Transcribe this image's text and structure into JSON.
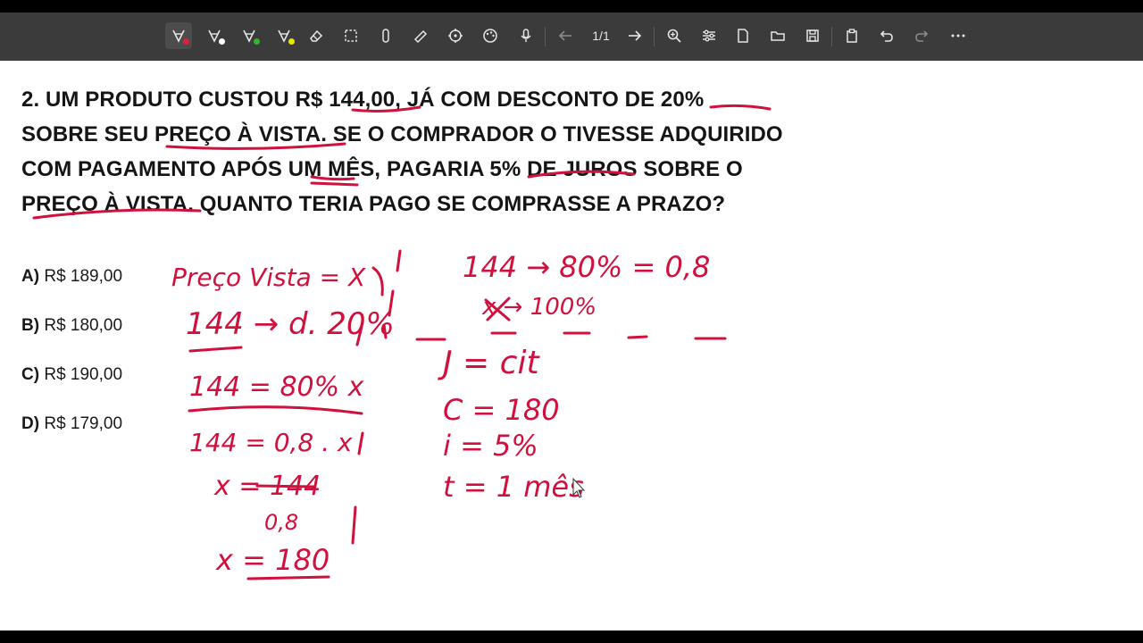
{
  "toolbar": {
    "page_counter": "1/1",
    "tools": [
      {
        "icon": "highlighter-pen-red-icon",
        "color": "#e0203a"
      },
      {
        "icon": "pen-white-icon",
        "color": "#ffffff"
      },
      {
        "icon": "pen-green-icon",
        "color": "#2fb52f"
      },
      {
        "icon": "pen-yellow-icon",
        "color": "#e6e600"
      },
      {
        "icon": "eraser-icon"
      },
      {
        "icon": "select-area-icon"
      },
      {
        "icon": "attach-icon"
      },
      {
        "icon": "ruler-icon"
      },
      {
        "icon": "move-icon"
      },
      {
        "icon": "palette-icon"
      },
      {
        "icon": "microphone-icon"
      },
      {
        "icon": "arrow-left-icon"
      },
      {
        "icon": "arrow-right-icon"
      },
      {
        "icon": "zoom-icon"
      },
      {
        "icon": "settings-sliders-icon"
      },
      {
        "icon": "new-file-icon"
      },
      {
        "icon": "open-folder-icon"
      },
      {
        "icon": "save-icon"
      },
      {
        "icon": "clipboard-icon"
      },
      {
        "icon": "undo-icon"
      },
      {
        "icon": "redo-icon"
      },
      {
        "icon": "more-icon"
      }
    ]
  },
  "question": {
    "lines": [
      "2. UM PRODUTO CUSTOU R$ 144,00, JÁ COM DESCONTO DE 20%",
      "SOBRE SEU PREÇO À VISTA. SE O COMPRADOR O TIVESSE ADQUIRIDO",
      "COM PAGAMENTO APÓS UM MÊS, PAGARIA 5% DE JUROS SOBRE O",
      "PREÇO À VISTA. QUANTO TERIA PAGO SE COMPRASSE A PRAZO?"
    ]
  },
  "options": [
    {
      "letter": "A)",
      "value": "R$ 189,00"
    },
    {
      "letter": "B)",
      "value": "R$ 180,00"
    },
    {
      "letter": "C)",
      "value": "R$ 190,00"
    },
    {
      "letter": "D)",
      "value": "R$ 179,00"
    }
  ],
  "ink": {
    "color": "#d0113e",
    "left": [
      "Preço Vista = X",
      "144 → d. 20%",
      "144 = 80% x",
      "144 = 0,8 . x",
      "x = 144",
      "0,8",
      "x = 180"
    ],
    "right": [
      "144 → 80% = 0,8",
      "x → 100%",
      "J = cit",
      "C = 180",
      "i = 5%",
      "t = 1 mês"
    ]
  }
}
